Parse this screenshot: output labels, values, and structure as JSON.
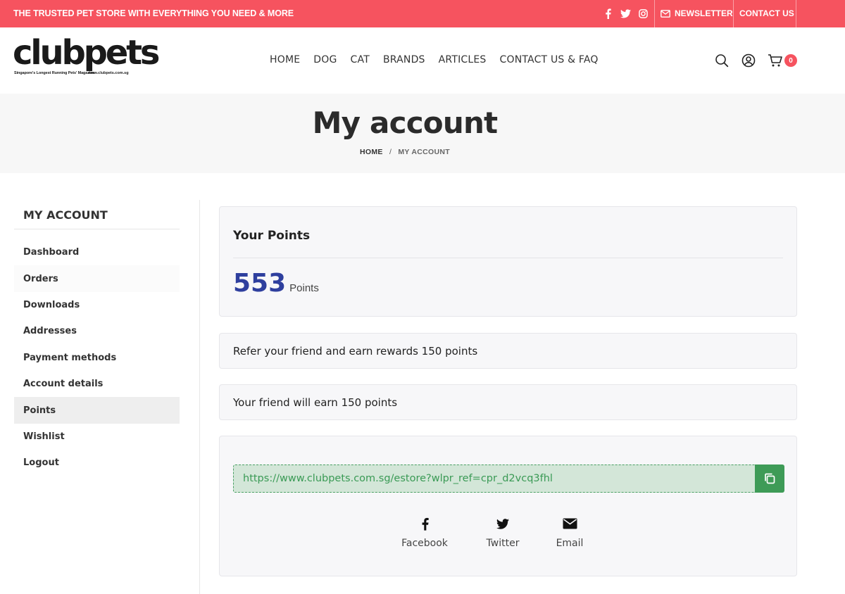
{
  "topbar": {
    "tagline": "THE TRUSTED PET STORE WITH EVERYTHING YOU NEED & MORE",
    "socials": [
      "facebook-icon",
      "twitter-icon",
      "instagram-icon"
    ],
    "newsletter": "NEWSLETTER",
    "contact": "CONTACT US",
    "bg_color": "#f6535f"
  },
  "header": {
    "logo_text": "clubpets",
    "logo_tagline": "Singapore's Longest Running Pets' Magazine",
    "logo_url_text": "www.clubpets.com.sg",
    "nav": [
      "HOME",
      "DOG",
      "CAT",
      "BRANDS",
      "ARTICLES",
      "CONTACT US & FAQ"
    ],
    "cart_count": "0"
  },
  "hero": {
    "title": "My account",
    "breadcrumb_home": "HOME",
    "breadcrumb_sep": "/",
    "breadcrumb_current": "MY ACCOUNT"
  },
  "sidebar": {
    "title": "MY ACCOUNT",
    "items": [
      "Dashboard",
      "Orders",
      "Downloads",
      "Addresses",
      "Payment methods",
      "Account details",
      "Points",
      "Wishlist",
      "Logout"
    ],
    "active": "Points"
  },
  "points": {
    "title": "Your Points",
    "value": "553",
    "unit": "Points",
    "value_color": "#2e3f9e"
  },
  "referral": {
    "refer_text": "Refer your friend and earn rewards 150 points",
    "friend_text": "Your friend will earn 150 points",
    "link": "https://www.clubpets.com.sg/estore?wlpr_ref=cpr_d2vcq3fhl",
    "share": [
      "Facebook",
      "Twitter",
      "Email"
    ],
    "accent": "#3e9b57"
  }
}
